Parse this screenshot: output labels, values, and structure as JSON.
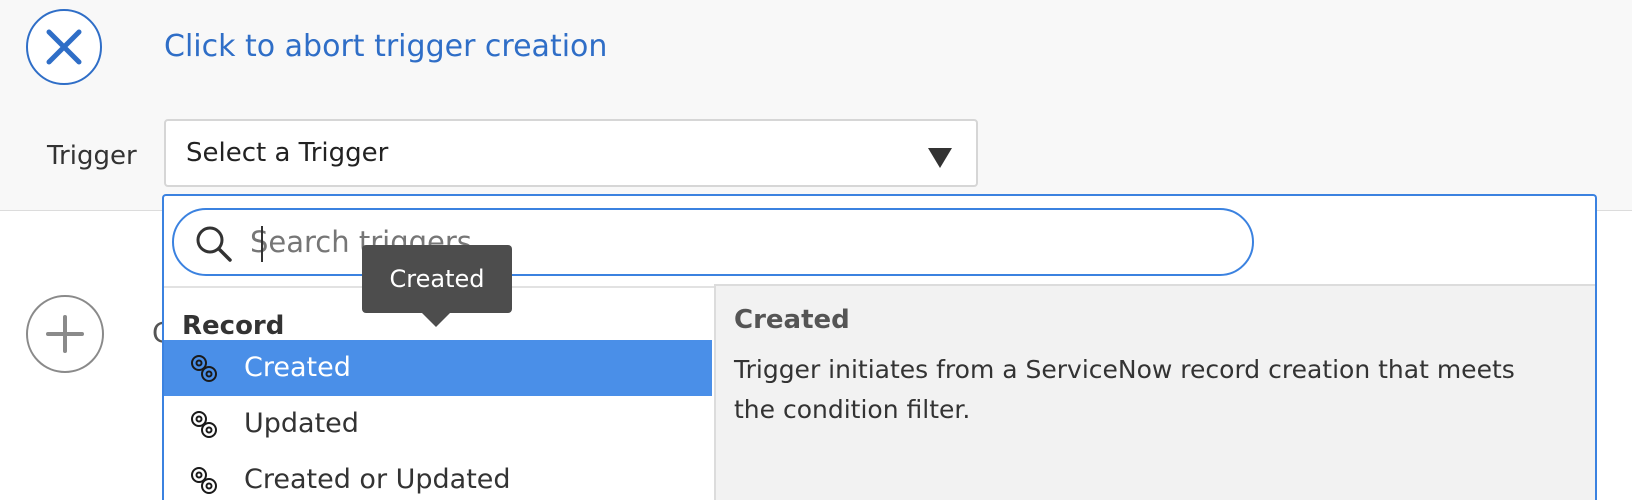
{
  "header": {
    "abort_link": "Click to abort trigger creation",
    "icons": {
      "abort": "close-icon",
      "add": "plus-icon"
    }
  },
  "trigger": {
    "label": "Trigger",
    "selected_value": "Select a Trigger"
  },
  "add_step_peek": "C",
  "dropdown": {
    "search_placeholder": "Search triggers",
    "search_value": "",
    "group_header": "Record",
    "items": [
      {
        "label": "Created",
        "icon": "gear-icon",
        "selected": true
      },
      {
        "label": "Updated",
        "icon": "gear-icon",
        "selected": false
      },
      {
        "label": "Created or Updated",
        "icon": "gear-icon",
        "selected": false
      }
    ],
    "detail": {
      "title": "Created",
      "description": "Trigger initiates from a ServiceNow record creation that meets the condition filter."
    }
  },
  "tooltip": {
    "text": "Created"
  },
  "colors": {
    "accent": "#2f6ec7",
    "selected_row": "#4a8fe8",
    "tooltip_bg": "#4d4d4d"
  }
}
